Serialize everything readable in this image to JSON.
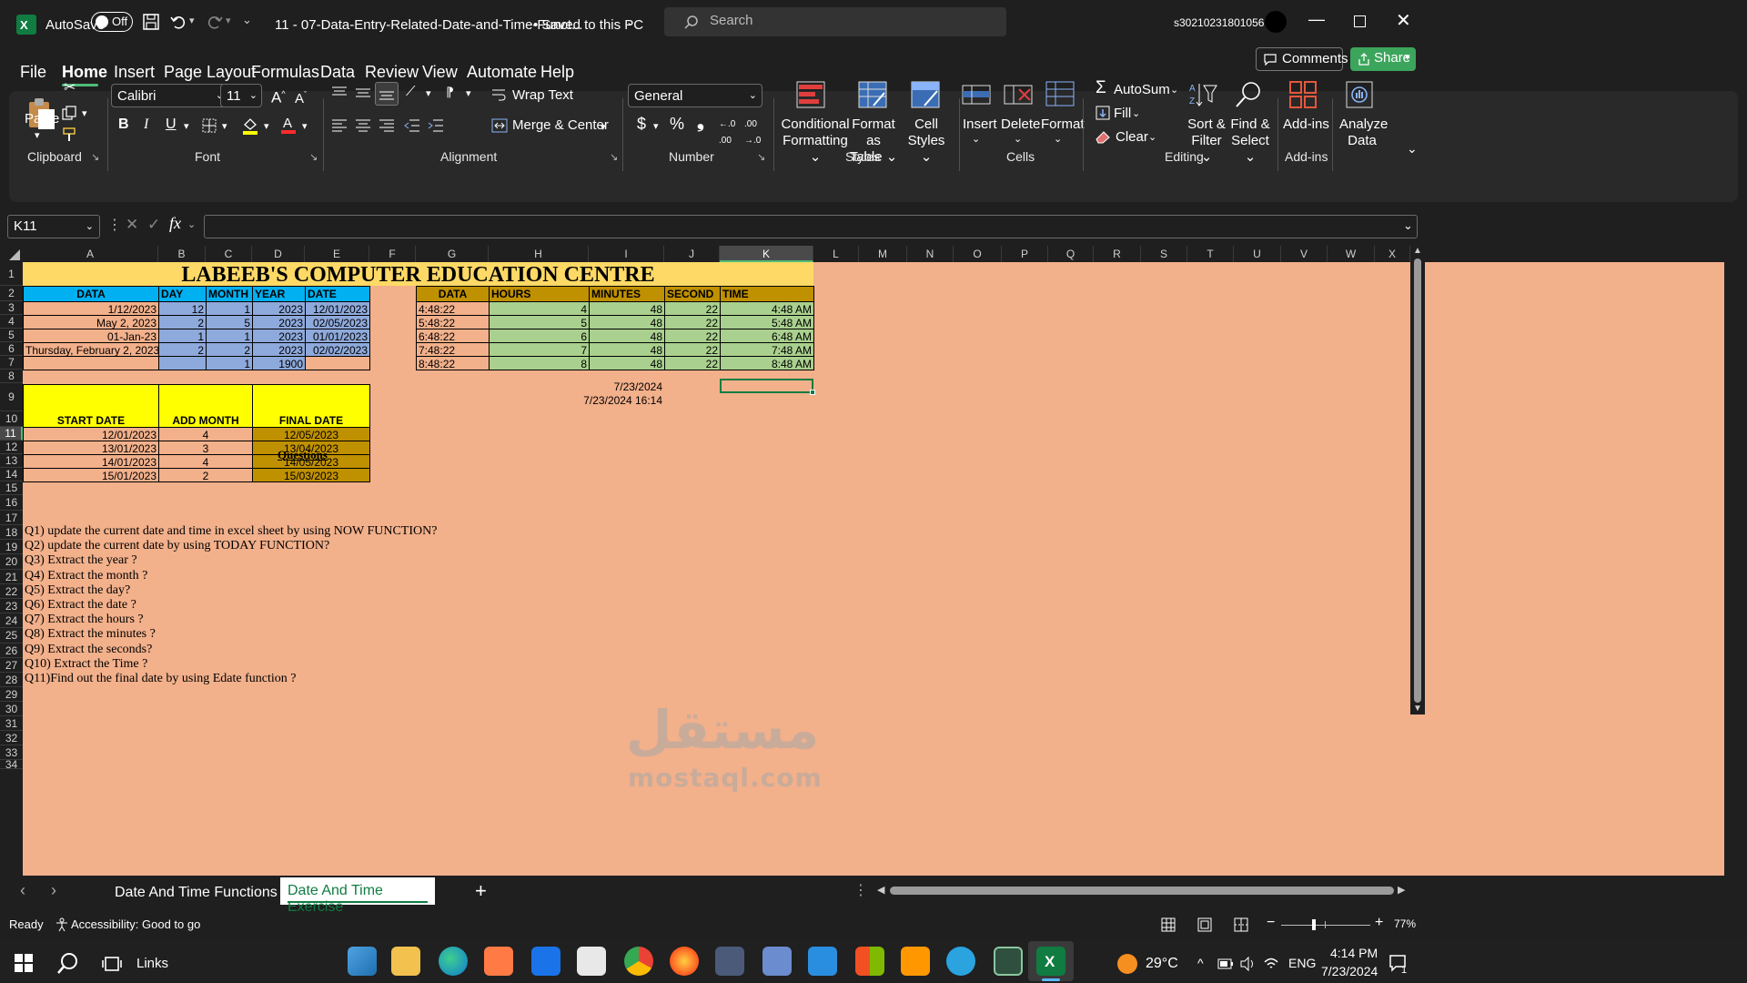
{
  "titlebar": {
    "autosave_label": "AutoSave",
    "autosave_state": "Off",
    "filename": "11 - 07-Data-Entry-Related-Date-and-Time-Funct...",
    "save_status": "• Saved to this PC",
    "search_placeholder": "Search",
    "user_id": "s30210231801056"
  },
  "menu": {
    "items": [
      "File",
      "Home",
      "Insert",
      "Page Layout",
      "Formulas",
      "Data",
      "Review",
      "View",
      "Automate",
      "Help"
    ],
    "active": "Home",
    "comments": "Comments",
    "share": "Share"
  },
  "ribbon": {
    "clipboard": {
      "paste": "Paste",
      "group": "Clipboard"
    },
    "font": {
      "name": "Calibri",
      "size": "11",
      "group": "Font"
    },
    "alignment": {
      "wrap": "Wrap Text",
      "merge": "Merge & Center",
      "group": "Alignment"
    },
    "number": {
      "format": "General",
      "group": "Number"
    },
    "styles": {
      "cond1": "Conditional",
      "cond2": "Formatting",
      "fmt1": "Format as",
      "fmt2": "Table",
      "cell1": "Cell",
      "cell2": "Styles",
      "group": "Styles"
    },
    "cells": {
      "insert": "Insert",
      "delete": "Delete",
      "format": "Format",
      "group": "Cells"
    },
    "editing": {
      "autosum": "AutoSum",
      "fill": "Fill",
      "clear": "Clear",
      "sort1": "Sort &",
      "sort2": "Filter",
      "find1": "Find &",
      "find2": "Select",
      "group": "Editing"
    },
    "addins": {
      "addins": "Add-ins",
      "group": "Add-ins"
    },
    "analyze": {
      "l1": "Analyze",
      "l2": "Data"
    }
  },
  "formula": {
    "namebox": "K11",
    "fx": "fx",
    "content": ""
  },
  "columns": [
    "A",
    "B",
    "C",
    "D",
    "E",
    "F",
    "G",
    "H",
    "I",
    "J",
    "K",
    "L",
    "M",
    "N",
    "O",
    "P",
    "Q",
    "R",
    "S",
    "T",
    "U",
    "V",
    "W",
    "X"
  ],
  "rows": [
    "1",
    "2",
    "3",
    "4",
    "5",
    "6",
    "7",
    "8",
    "9",
    "10",
    "11",
    "12",
    "13",
    "14",
    "15",
    "16",
    "17",
    "18",
    "19",
    "20",
    "21",
    "22",
    "23",
    "24",
    "25",
    "26",
    "27",
    "28",
    "29",
    "30",
    "31",
    "32",
    "33",
    "34"
  ],
  "sheet": {
    "title": "LABEEB'S COMPUTER EDUCATION CENTRE",
    "table1": {
      "headers": [
        "DATA",
        "DAY",
        "MONTH",
        "YEAR",
        "DATE"
      ],
      "rows": [
        [
          "1/12/2023",
          "12",
          "1",
          "2023",
          "12/01/2023"
        ],
        [
          "May 2, 2023",
          "2",
          "5",
          "2023",
          "02/05/2023"
        ],
        [
          "01-Jan-23",
          "1",
          "1",
          "2023",
          "01/01/2023"
        ],
        [
          "Thursday, February 2, 2023",
          "2",
          "2",
          "2023",
          "02/02/2023"
        ],
        [
          "",
          "",
          "1",
          "1900",
          ""
        ]
      ]
    },
    "table2": {
      "headers": [
        "DATA",
        "HOURS",
        "MINUTES",
        "SECOND",
        "TIME"
      ],
      "rows": [
        [
          "4:48:22",
          "4",
          "48",
          "22",
          "4:48 AM"
        ],
        [
          "5:48:22",
          "5",
          "48",
          "22",
          "5:48 AM"
        ],
        [
          "6:48:22",
          "6",
          "48",
          "22",
          "6:48 AM"
        ],
        [
          "7:48:22",
          "7",
          "48",
          "22",
          "7:48 AM"
        ],
        [
          "8:48:22",
          "8",
          "48",
          "22",
          "8:48 AM"
        ]
      ]
    },
    "table3": {
      "headers": [
        "START DATE",
        "ADD MONTH",
        "FINAL DATE"
      ],
      "rows": [
        [
          "12/01/2023",
          "4",
          "12/05/2023"
        ],
        [
          "13/01/2023",
          "3",
          "13/04/2023"
        ],
        [
          "14/01/2023",
          "4",
          "14/05/2023"
        ],
        [
          "15/01/2023",
          "2",
          "15/03/2023"
        ]
      ]
    },
    "today_value": "7/23/2024",
    "now_value": "7/23/2024 16:14",
    "questions_title": "Questions",
    "questions": [
      "Q1) update the current date and time in excel sheet  by using NOW FUNCTION?",
      "Q2) update the current date  by using TODAY FUNCTION?",
      "Q3) Extract the year ?",
      "Q4) Extract the month ?",
      "Q5) Extract the day?",
      "Q6) Extract the date ?",
      "Q7) Extract the hours ?",
      "Q8) Extract the minutes ?",
      "Q9) Extract the seconds?",
      "Q10) Extract the Time ?",
      "Q11)Find out the final date by using Edate function ?"
    ]
  },
  "tabs": {
    "sheets": [
      "Date And Time Functions",
      "Date And Time Exercise"
    ],
    "active": "Date And Time Exercise"
  },
  "status": {
    "ready": "Ready",
    "accessibility": "Accessibility: Good to go",
    "zoom": "77%"
  },
  "watermark": {
    "arabic": "مستقل",
    "latin": "mostaql.com"
  },
  "taskbar": {
    "links": "Links",
    "temp": "29°C",
    "lang": "ENG",
    "time": "4:14 PM",
    "date": "7/23/2024",
    "notif_count": "1"
  },
  "colors": {
    "accent_green": "#107c41",
    "sheet_bg": "#f2b08b",
    "title_yellow": "#ffd966",
    "blue_header": "#00b0f0",
    "grid_blue": "#8ea9db",
    "yellow": "#ffff00",
    "gold": "#bf9000",
    "green": "#a9d08e"
  }
}
